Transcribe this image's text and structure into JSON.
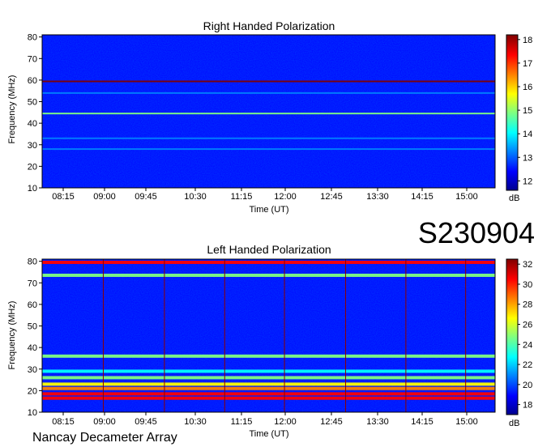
{
  "stamp": "S230904",
  "credit": "Nancay Decameter Array",
  "chart_data": [
    {
      "type": "heatmap",
      "title": "Right Handed Polarization",
      "xlabel": "Time (UT)",
      "ylabel": "Frequency (MHz)",
      "x_ticks": [
        "08:15",
        "09:00",
        "09:45",
        "10:30",
        "11:15",
        "12:00",
        "12:45",
        "13:30",
        "14:15",
        "15:00"
      ],
      "y_ticks": [
        10,
        20,
        30,
        40,
        50,
        60,
        70,
        80
      ],
      "ylim": [
        10,
        81
      ],
      "colorbar": {
        "label": "dB",
        "ticks": [
          12,
          13,
          14,
          15,
          16,
          17,
          18
        ],
        "range": [
          11.6,
          18.2
        ]
      },
      "colormap": [
        "#00008f",
        "#0000ff",
        "#0080ff",
        "#00ffff",
        "#80ff80",
        "#ffff00",
        "#ff8000",
        "#ff0000",
        "#800000"
      ],
      "background_level": 12.3,
      "bands": [
        {
          "freq": 59.4,
          "level": 18.0
        },
        {
          "freq": 44.5,
          "level": 15.0
        },
        {
          "freq": 54.0,
          "level": 13.4
        },
        {
          "freq": 28.0,
          "level": 13.2
        },
        {
          "freq": 33.0,
          "level": 12.9
        }
      ]
    },
    {
      "type": "heatmap",
      "title": "Left Handed Polarization",
      "xlabel": "Time (UT)",
      "ylabel": "Frequency (MHz)",
      "x_ticks": [
        "08:15",
        "09:00",
        "09:45",
        "10:30",
        "11:15",
        "12:00",
        "12:45",
        "13:30",
        "14:15",
        "15:00"
      ],
      "y_ticks": [
        10,
        20,
        30,
        40,
        50,
        60,
        70,
        80
      ],
      "ylim": [
        10,
        81
      ],
      "colorbar": {
        "label": "dB",
        "ticks": [
          18,
          20,
          22,
          24,
          26,
          28,
          30,
          32
        ],
        "range": [
          17.0,
          32.5
        ]
      },
      "colormap": [
        "#00008f",
        "#0000ff",
        "#0080ff",
        "#00ffff",
        "#80ff80",
        "#ffff00",
        "#ff8000",
        "#ff0000",
        "#800000"
      ],
      "background_level": 19.5,
      "bands": [
        {
          "freq": 16.5,
          "level": 31.5
        },
        {
          "freq": 18.5,
          "level": 30.0
        },
        {
          "freq": 21.0,
          "level": 28.0
        },
        {
          "freq": 23.0,
          "level": 26.5
        },
        {
          "freq": 26.0,
          "level": 25.0
        },
        {
          "freq": 29.0,
          "level": 23.5
        },
        {
          "freq": 36.0,
          "level": 25.5
        },
        {
          "freq": 73.5,
          "level": 24.0
        },
        {
          "freq": 79.5,
          "level": 30.0
        }
      ]
    }
  ]
}
